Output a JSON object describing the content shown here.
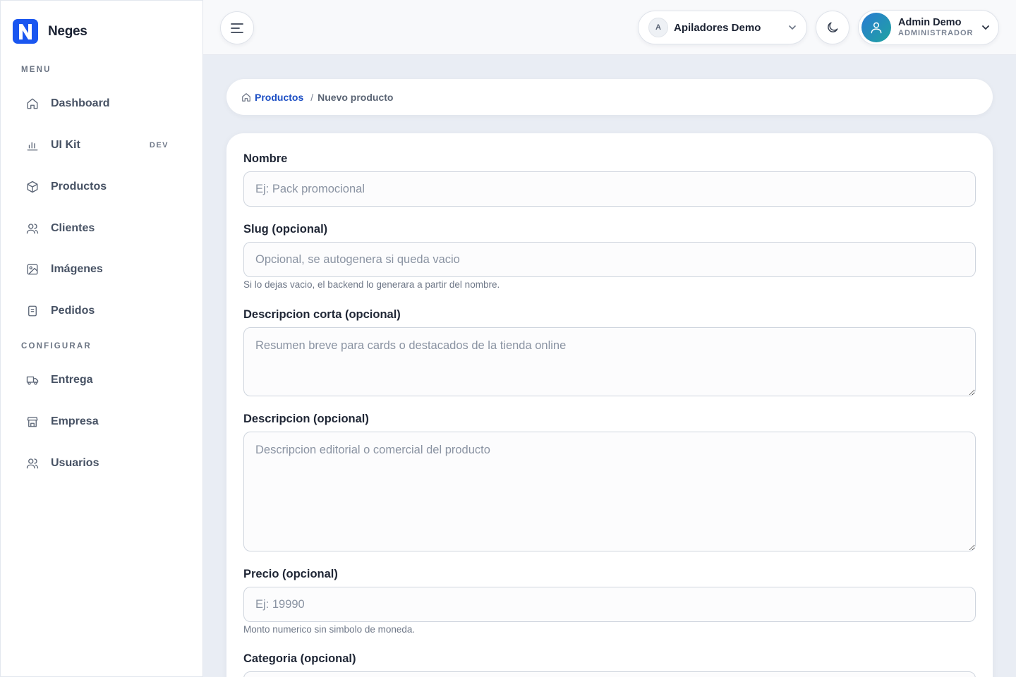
{
  "brand": {
    "name": "Neges",
    "logo_letter": "N",
    "color": "#1a56f0"
  },
  "sidebar": {
    "menu_label": "MENU",
    "config_label": "CONFIGURAR",
    "menu_items": [
      {
        "label": "Dashboard",
        "icon": "home-icon"
      },
      {
        "label": "UI Kit",
        "icon": "bar-chart-icon",
        "badge": "DEV"
      },
      {
        "label": "Productos",
        "icon": "box-icon"
      },
      {
        "label": "Clientes",
        "icon": "users-icon"
      },
      {
        "label": "Imágenes",
        "icon": "image-icon"
      },
      {
        "label": "Pedidos",
        "icon": "receipt-icon"
      }
    ],
    "config_items": [
      {
        "label": "Entrega",
        "icon": "truck-icon"
      },
      {
        "label": "Empresa",
        "icon": "store-icon"
      },
      {
        "label": "Usuarios",
        "icon": "users-icon"
      }
    ]
  },
  "topbar": {
    "org": {
      "avatar_letter": "A",
      "name": "Apiladores Demo"
    },
    "user": {
      "name": "Admin Demo",
      "role": "ADMINISTRADOR"
    }
  },
  "breadcrumb": {
    "parent": "Productos",
    "separator": "/",
    "current": "Nuevo producto"
  },
  "form": {
    "nombre": {
      "label": "Nombre",
      "placeholder": "Ej: Pack promocional",
      "value": ""
    },
    "slug": {
      "label": "Slug (opcional)",
      "placeholder": "Opcional, se autogenera si queda vacio",
      "value": "",
      "help": "Si lo dejas vacio, el backend lo generara a partir del nombre."
    },
    "descripcion_corta": {
      "label": "Descripcion corta (opcional)",
      "placeholder": "Resumen breve para cards o destacados de la tienda online",
      "value": ""
    },
    "descripcion": {
      "label": "Descripcion (opcional)",
      "placeholder": "Descripcion editorial o comercial del producto",
      "value": ""
    },
    "precio": {
      "label": "Precio (opcional)",
      "placeholder": "Ej: 19990",
      "value": "",
      "help": "Monto numerico sin simbolo de moneda."
    },
    "categoria": {
      "label": "Categoria (opcional)"
    }
  }
}
